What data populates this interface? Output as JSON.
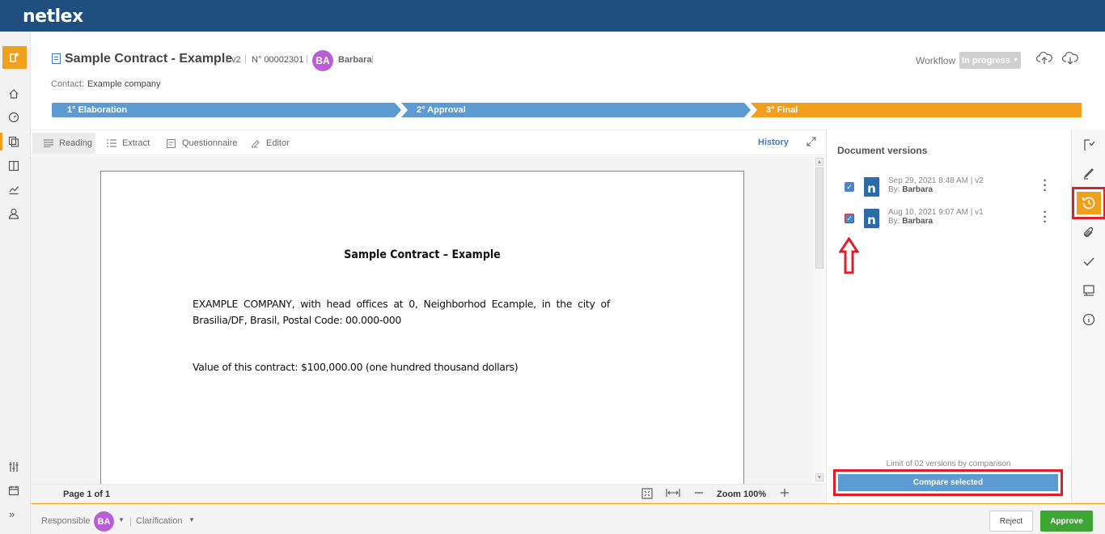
{
  "app": {
    "logo": "netlex"
  },
  "header": {
    "title": "Sample Contract - Example",
    "version": "v2",
    "number": "N° 00002301",
    "avatar_initials": "BA",
    "user": "Barbara",
    "contact_label": "Contact:",
    "contact_value": "Example company",
    "workflow_label": "Workflow",
    "workflow_status": "In progress"
  },
  "stepper": {
    "steps": [
      {
        "label": "1° Elaboration",
        "color": "#5b9bd1"
      },
      {
        "label": "2° Approval",
        "color": "#5b9bd1"
      },
      {
        "label": "3° Final",
        "color": "#f29e1c"
      }
    ]
  },
  "tabs": [
    {
      "label": "Reading",
      "icon": "lines-icon",
      "active": true
    },
    {
      "label": "Extract",
      "icon": "list-icon",
      "active": false
    },
    {
      "label": "Questionnaire",
      "icon": "form-icon",
      "active": false
    },
    {
      "label": "Editor",
      "icon": "edit-icon",
      "active": false
    }
  ],
  "history_label": "History",
  "document": {
    "title": "Sample Contract – Example",
    "paragraph": "EXAMPLE COMPANY, with head offices at 0,  Neighborhod Ecample, in the city of Brasilia/DF, Brasil, Postal Code: 00.000-000",
    "value_line": "Value of this contract: $100,000.00 (one hundred thousand dollars)"
  },
  "doc_footer": {
    "page_count": "Page 1 of 1",
    "zoom": "Zoom 100%"
  },
  "versions": {
    "title": "Document versions",
    "items": [
      {
        "date": "Sep 29, 2021 8:48 AM | v2",
        "by_label": "By:",
        "by": "Barbara",
        "checked": true,
        "logo": "n"
      },
      {
        "date": "Aug 10, 2021 9:07 AM | v1",
        "by_label": "By:",
        "by": "Barbara",
        "checked": true,
        "logo": "n"
      }
    ],
    "limit_text": "Limit of 02 versions by comparison",
    "compare_label": "Compare selected"
  },
  "footer": {
    "responsible_label": "Responsible",
    "avatar_initials": "BA",
    "clarification": "Clarification",
    "reject_label": "Reject",
    "approve_label": "Approve"
  },
  "colors": {
    "topbar": "#1e4f7e",
    "accent": "#f0a01a",
    "step_blue": "#5b9bd1",
    "approve": "#3da531",
    "highlight_red": "#e01f2a",
    "avatar": "#b85ed6"
  }
}
